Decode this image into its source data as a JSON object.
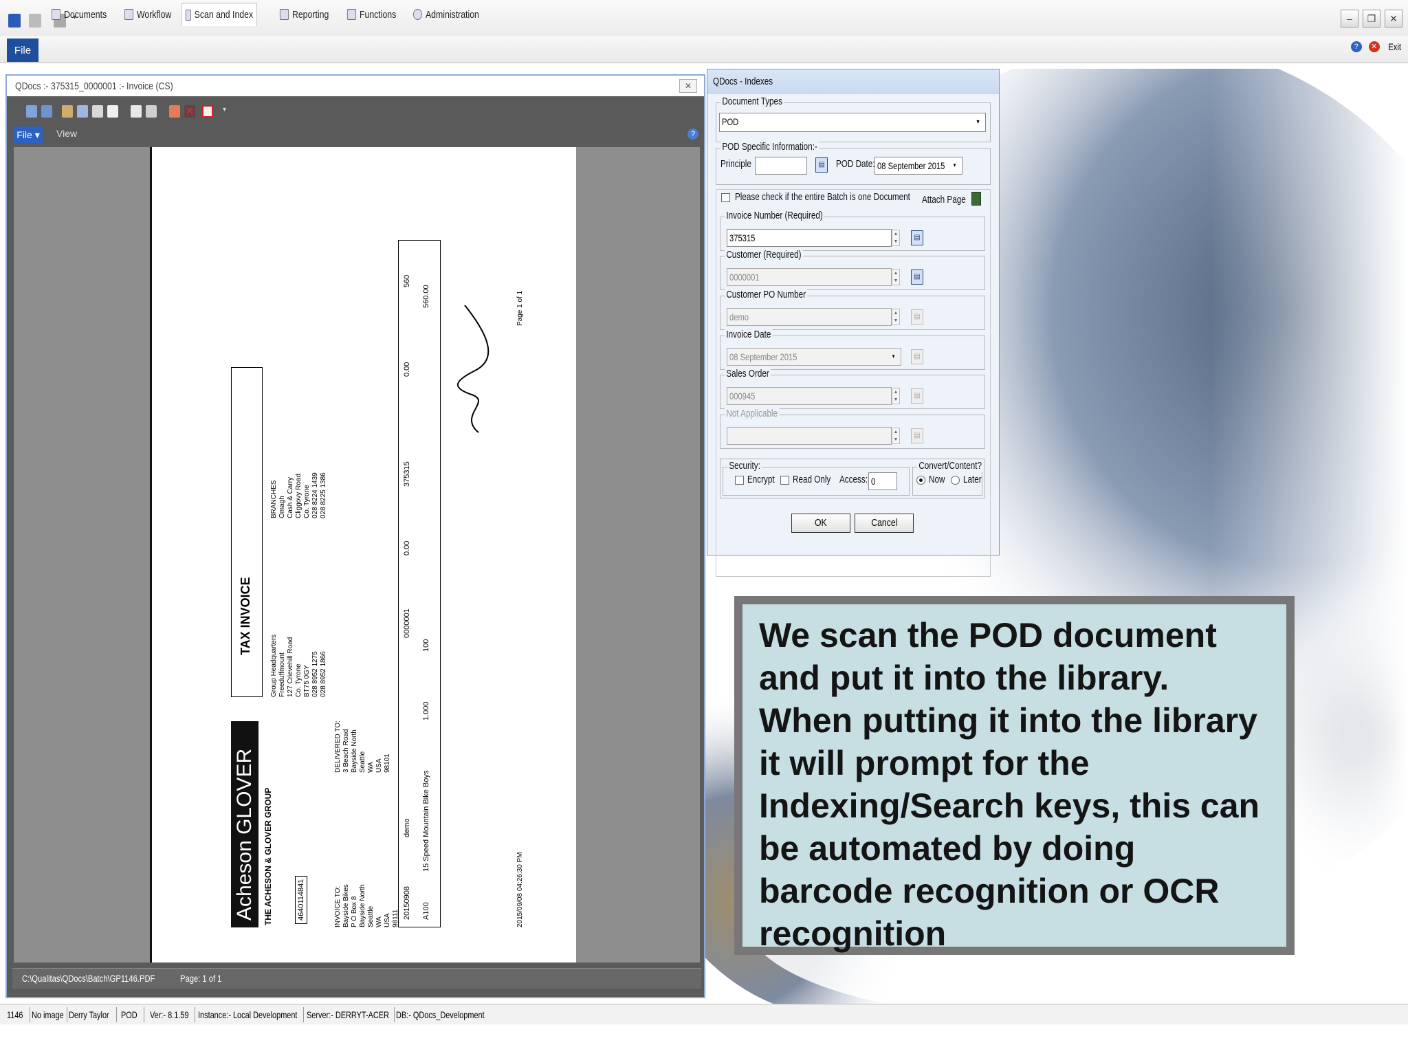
{
  "ribbon": {
    "file": "File",
    "tabs": [
      "Documents",
      "Workflow",
      "Scan and Index",
      "Reporting",
      "Functions",
      "Administration"
    ],
    "exit": "Exit"
  },
  "doc_window": {
    "title": "QDocs :- 375315_0000001 :- Invoice (CS)",
    "file_menu": "File ▾",
    "view_menu": "View",
    "path": "C:\\Qualitas\\QDocs\\Batch\\GP1146.PDF",
    "page": "Page: 1 of 1"
  },
  "invoice": {
    "title": "TAX INVOICE",
    "brand": "Acheson GLOVER",
    "group": "THE ACHESON & GLOVER GROUP",
    "hq": [
      "Group Headquarters",
      "Freeduffmount",
      "127 Crievehill Road",
      "Co. Tyrone",
      "BT75 0GY",
      "028 8952 1275",
      "028 8952 1866"
    ],
    "branches": [
      "BRANCHES",
      "Omagh",
      "Cash & Carry",
      "Cliggovy Road",
      "Co. Tyrone",
      "028 8224 1439",
      "028 8225 1386"
    ],
    "invoice_to": [
      "INVOICE TO:",
      "Bayside Bikes",
      "P O Box 8",
      "Bayside North",
      "Seattle",
      "WA",
      "USA",
      "98111"
    ],
    "delivered_to": [
      "DELIVERED TO:",
      "3 Beach Road",
      "Bayside North",
      "Seattle",
      "WA",
      "USA",
      "98101"
    ],
    "vat": "4640114841",
    "date": "20150908",
    "cust_po": "demo",
    "account": "0000001",
    "invoice_no": "375315",
    "qty": "1.000",
    "price": "100",
    "discount": "0.00",
    "vat_amt": "0.00",
    "amount": "560.00",
    "total": "560",
    "item": "A100",
    "desc": "15 Speed Mountain Bike Boys",
    "page": "Page 1 of 1",
    "stamp": "2015/09/08 04:26:30 PM"
  },
  "indexes": {
    "title": "QDocs - Indexes",
    "doc_types_label": "Document Types",
    "doc_type": "POD",
    "pod_group": "POD Specific Information:-",
    "principle_label": "Principle",
    "pod_date_label": "POD Date:",
    "pod_date": "08 September 2015",
    "batch_check": "Please check if the entire Batch is one Document",
    "attach_page": "Attach Page",
    "fields": [
      {
        "label": "Invoice Number (Required)",
        "value": "375315",
        "enabled": true
      },
      {
        "label": "Customer (Required)",
        "value": "0000001",
        "enabled": true
      },
      {
        "label": "Customer PO Number",
        "value": "demo",
        "enabled": false
      },
      {
        "label": "Invoice Date",
        "value": "08 September 2015",
        "enabled": false
      },
      {
        "label": "Sales Order",
        "value": "000945",
        "enabled": false
      },
      {
        "label": "Not Applicable",
        "value": "",
        "enabled": false
      }
    ],
    "security_label": "Security:",
    "encrypt": "Encrypt",
    "read_only": "Read Only",
    "access_label": "Access:",
    "access_value": "0",
    "convert_label": "Convert/Content?",
    "now": "Now",
    "later": "Later",
    "ok": "OK",
    "cancel": "Cancel"
  },
  "caption": "We scan the POD document and put it into the library. When putting it into the library it will prompt for the Indexing/Search keys, this can be automated by doing barcode recognition or OCR recognition",
  "status": [
    "1146",
    "No image",
    "Derry Taylor",
    "POD",
    "Ver:- 8.1.59",
    "Instance:- Local Development",
    "Server:- DERRYT-ACER",
    "DB:- QDocs_Development"
  ],
  "colors": {
    "ribbon_file": "#1f4f9c",
    "doc_bg": "#5b5b5b",
    "caption_bg": "#c7dee3",
    "caption_border": "#777777"
  }
}
